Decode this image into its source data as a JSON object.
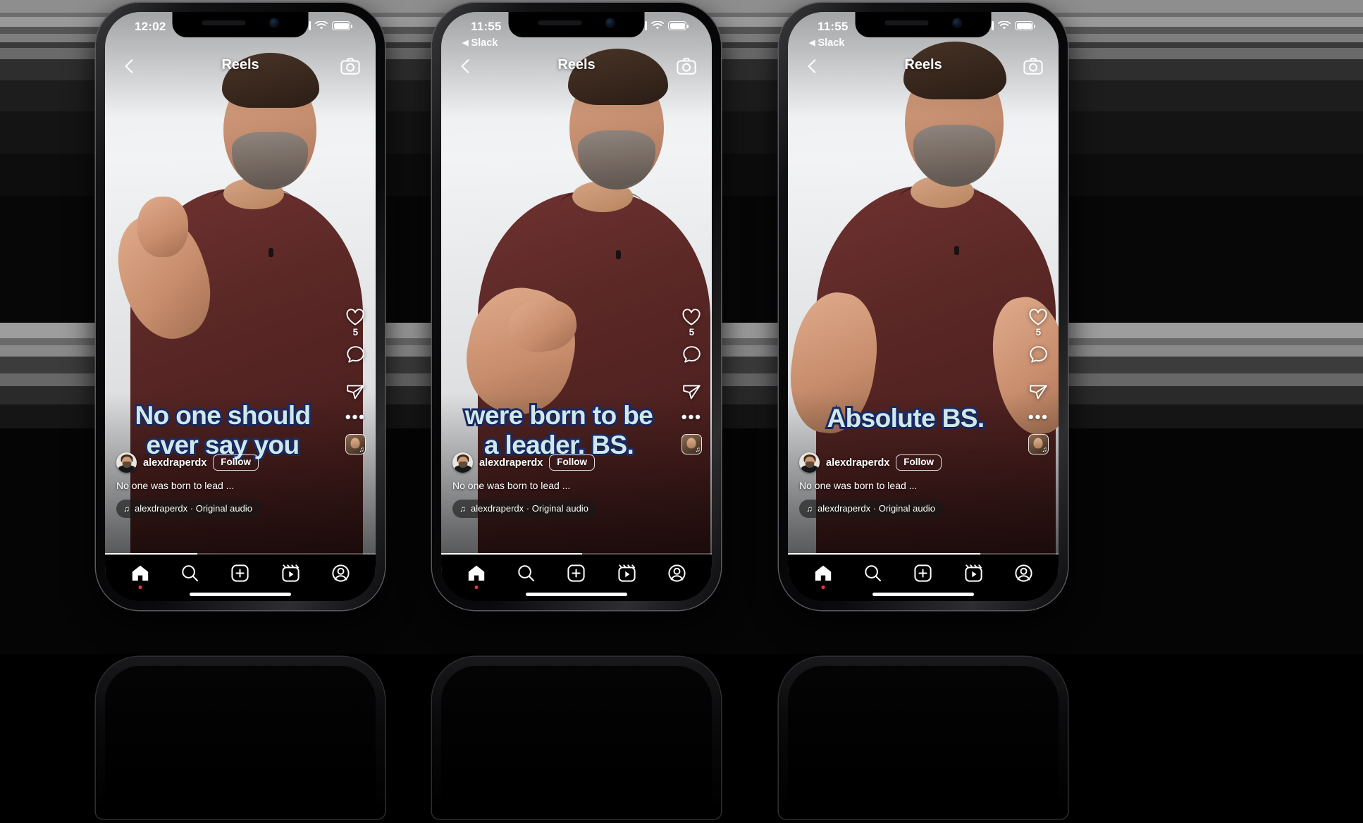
{
  "app": {
    "name": "Instagram Reels",
    "screen_title": "Reels"
  },
  "icons": {
    "back": "chevron-left-icon",
    "camera": "camera-icon",
    "like": "heart-icon",
    "comment": "comment-bubble-icon",
    "share": "paper-plane-icon",
    "more": "more-options-icon",
    "audio": "music-note-icon",
    "home": "home-icon",
    "search": "search-icon",
    "create": "plus-square-icon",
    "reels": "reels-icon",
    "profile": "profile-avatar-icon",
    "wifi": "wifi-icon",
    "battery": "battery-icon",
    "cellular": "cellular-bars-icon"
  },
  "colors": {
    "caption_fill": "#cfe9ea",
    "caption_stroke": "#1b2a63",
    "shirt": "#592725",
    "nav_background": "#000000",
    "notification_dot": "#ff2d4b"
  },
  "phones": [
    {
      "id": "phone-1",
      "status": {
        "time": "12:02",
        "back_app": "",
        "show_back_app": false,
        "signal": "cellular-bars-icon",
        "wifi": "wifi-icon",
        "battery": "battery-icon"
      },
      "topbar": {
        "title": "Reels"
      },
      "caption_lines": [
        "No one should",
        "ever say you"
      ],
      "caption_layout": "two-line",
      "actions": {
        "like_count": "5",
        "more_dots": "•••"
      },
      "meta": {
        "username": "alexdraperdx",
        "follow_label": "Follow",
        "description": "No one was born to lead ...",
        "audio_label": "alexdraperdx · Original audio"
      },
      "progress_percent": 34
    },
    {
      "id": "phone-2",
      "status": {
        "time": "11:55",
        "back_app": "Slack",
        "show_back_app": true,
        "signal": "cellular-bars-icon",
        "wifi": "wifi-icon",
        "battery": "battery-icon"
      },
      "topbar": {
        "title": "Reels"
      },
      "caption_lines": [
        "were born to be",
        "a leader. BS."
      ],
      "caption_layout": "two-line",
      "actions": {
        "like_count": "5",
        "more_dots": "•••"
      },
      "meta": {
        "username": "alexdraperdx",
        "follow_label": "Follow",
        "description": "No one was born to lead ...",
        "audio_label": "alexdraperdx · Original audio"
      },
      "progress_percent": 52
    },
    {
      "id": "phone-3",
      "status": {
        "time": "11:55",
        "back_app": "Slack",
        "show_back_app": true,
        "signal": "cellular-bars-icon",
        "wifi": "wifi-icon",
        "battery": "battery-icon"
      },
      "topbar": {
        "title": "Reels"
      },
      "caption_lines": [
        "Absolute BS."
      ],
      "caption_layout": "one-line",
      "actions": {
        "like_count": "5",
        "more_dots": "•••"
      },
      "meta": {
        "username": "alexdraperdx",
        "follow_label": "Follow",
        "description": "No one was born to lead ...",
        "audio_label": "alexdraperdx · Original audio"
      },
      "progress_percent": 71
    }
  ],
  "navbar": {
    "items": [
      {
        "name": "home",
        "label": "Home",
        "has_dot": true
      },
      {
        "name": "search",
        "label": "Search",
        "has_dot": false
      },
      {
        "name": "create",
        "label": "Create",
        "has_dot": false
      },
      {
        "name": "reels",
        "label": "Reels",
        "has_dot": false
      },
      {
        "name": "profile",
        "label": "Profile",
        "has_dot": false
      }
    ]
  }
}
